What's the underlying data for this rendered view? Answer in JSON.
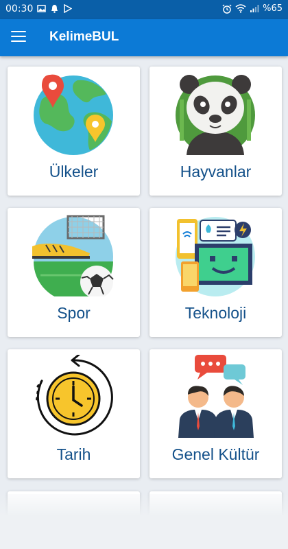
{
  "status_bar": {
    "time": "00:30",
    "battery": "%65",
    "left_icons": [
      "image-icon",
      "notification-icon",
      "play-store-icon"
    ],
    "right_icons": [
      "alarm-icon",
      "wifi-icon",
      "signal-icon"
    ]
  },
  "app_bar": {
    "title": "KelimeBUL",
    "menu_icon": "hamburger-menu-icon"
  },
  "categories": [
    {
      "label": "Ülkeler",
      "icon": "globe-map-pin-icon"
    },
    {
      "label": "Hayvanlar",
      "icon": "panda-icon"
    },
    {
      "label": "Spor",
      "icon": "football-icon"
    },
    {
      "label": "Teknoloji",
      "icon": "technology-devices-icon"
    },
    {
      "label": "Tarih",
      "icon": "history-clock-icon"
    },
    {
      "label": "Genel Kültür",
      "icon": "people-conversation-icon"
    }
  ],
  "colors": {
    "status_bar": "#0a5fa8",
    "app_bar": "#0c7ad6",
    "background": "#e9edf2",
    "card": "#ffffff",
    "label": "#14518a"
  }
}
